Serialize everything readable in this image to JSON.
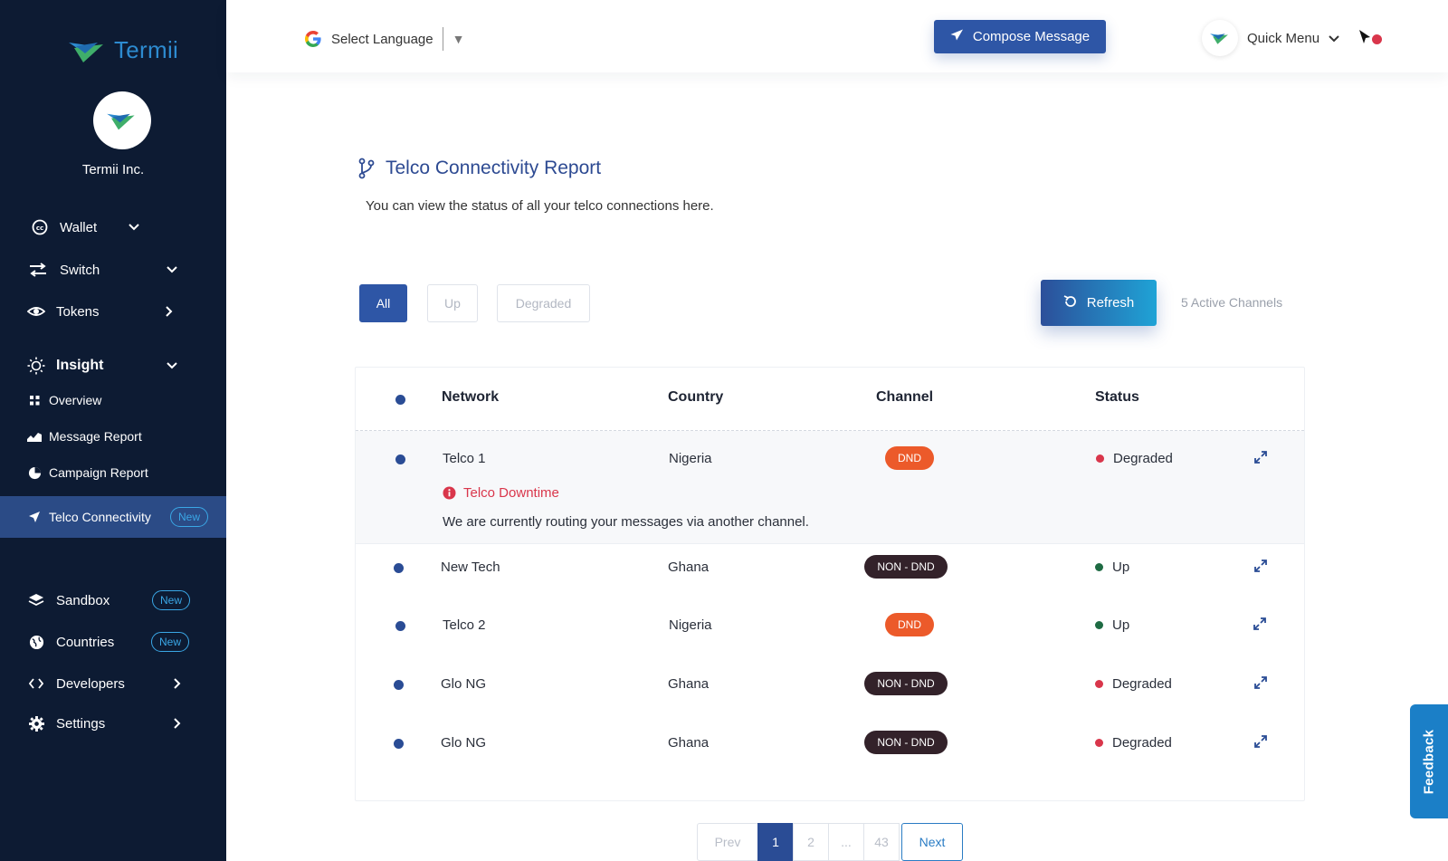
{
  "sidebar": {
    "brand": "Termii",
    "org_name": "Termii Inc.",
    "items": [
      {
        "label": "Wallet",
        "icon": "wallet-icon",
        "chevron": "down"
      },
      {
        "label": "Switch",
        "icon": "switch-icon",
        "chevron": "down"
      },
      {
        "label": "Tokens",
        "icon": "tokens-icon",
        "chevron": "right"
      },
      {
        "label": "Insight",
        "icon": "insight-icon",
        "chevron": "down"
      }
    ],
    "insight_sub": [
      {
        "label": "Overview",
        "icon": "grid-icon"
      },
      {
        "label": "Message Report",
        "icon": "area-chart-icon"
      },
      {
        "label": "Campaign Report",
        "icon": "pie-chart-icon"
      },
      {
        "label": "Telco Connectivity",
        "icon": "send-icon",
        "badge": "New"
      }
    ],
    "bottom_items": [
      {
        "label": "Sandbox",
        "icon": "layers-icon",
        "badge": "New"
      },
      {
        "label": "Countries",
        "icon": "globe-icon",
        "badge": "New"
      },
      {
        "label": "Developers",
        "icon": "code-icon",
        "chevron": "right"
      },
      {
        "label": "Settings",
        "icon": "gear-icon",
        "chevron": "right"
      }
    ]
  },
  "header": {
    "language_label": "Select Language",
    "compose_label": "Compose Message",
    "quick_menu_label": "Quick Menu"
  },
  "page": {
    "title": "Telco Connectivity Report",
    "subtitle": "You can view the status of all your telco connections here.",
    "filters": [
      "All",
      "Up",
      "Degraded"
    ],
    "active_filter": "All",
    "refresh_label": "Refresh",
    "active_channels": "5 Active Channels"
  },
  "table": {
    "columns": [
      "Network",
      "Country",
      "Channel",
      "Status"
    ],
    "rows": [
      {
        "network": "Telco 1",
        "country": "Nigeria",
        "channel": "DND",
        "status": "Degraded",
        "expanded": true,
        "alert_title": "Telco Downtime",
        "alert_message": "We are currently routing your messages via another channel."
      },
      {
        "network": "New Tech",
        "country": "Ghana",
        "channel": "NON - DND",
        "status": "Up"
      },
      {
        "network": "Telco 2",
        "country": "Nigeria",
        "channel": "DND",
        "status": "Up"
      },
      {
        "network": "Glo NG",
        "country": "Ghana",
        "channel": "NON - DND",
        "status": "Degraded"
      },
      {
        "network": "Glo NG",
        "country": "Ghana",
        "channel": "NON - DND",
        "status": "Degraded"
      }
    ]
  },
  "pagination": {
    "prev": "Prev",
    "pages": [
      "1",
      "2",
      "...",
      "43"
    ],
    "current": "1",
    "next": "Next"
  },
  "feedback_label": "Feedback",
  "colors": {
    "sidebar_bg": "#0d1b33",
    "primary": "#2e56a6",
    "accent": "#1fa3d6",
    "dnd": "#ec5a2a",
    "non_dnd": "#33222a",
    "degraded": "#d9364b",
    "up": "#1e6b43"
  }
}
